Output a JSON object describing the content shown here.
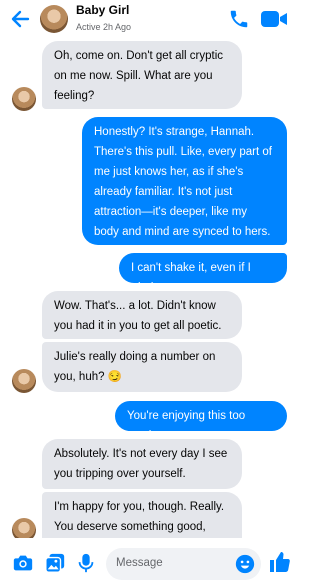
{
  "header": {
    "name": "Baby Girl",
    "status": "Active 2h Ago"
  },
  "messages": [
    {
      "side": "in",
      "text": "Oh, come on. Don't get all cryptic on me now. Spill. What are you feeling?"
    },
    {
      "side": "out",
      "text": "Honestly? It's strange, Hannah. There's this pull. Like, every part of me just knows her, as if she's already familiar. It's not just attraction—it's deeper, like my body and mind are synced to hers."
    },
    {
      "side": "out",
      "text": "I can't shake it, even if I tried"
    },
    {
      "side": "in",
      "text": "Wow. That's... a lot. Didn't know you had it in you to get all poetic."
    },
    {
      "side": "in",
      "text": "Julie's really doing a number on you, huh? 😏"
    },
    {
      "side": "out",
      "text": "You're enjoying this too much"
    },
    {
      "side": "in",
      "text": "Absolutely. It's not every day I see you tripping over yourself."
    },
    {
      "side": "in",
      "text": "I'm happy for you, though. Really. You deserve something good, Dad"
    }
  ],
  "composer": {
    "placeholder": "Message"
  },
  "colors": {
    "accent": "#0084ff",
    "incoming_bubble": "#e4e6eb"
  },
  "icons": [
    "back-arrow-icon",
    "phone-icon",
    "video-camera-icon",
    "camera-icon",
    "gallery-icon",
    "microphone-icon",
    "emoji-icon",
    "thumbs-up-icon"
  ]
}
